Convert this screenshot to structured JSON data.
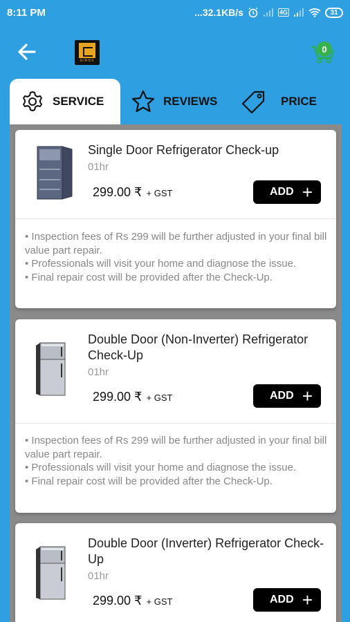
{
  "status": {
    "time": "8:11 PM",
    "speed": "...32.1KB/s",
    "network": "4G",
    "battery": "31"
  },
  "header": {
    "logo_text": "GIRDS",
    "cart_count": "0"
  },
  "tabs": [
    {
      "label": "SERVICE"
    },
    {
      "label": "REVIEWS"
    },
    {
      "label": "PRICE"
    }
  ],
  "services": [
    {
      "title": "Single Door Refrigerator Check-up",
      "duration": "01hr",
      "price": "299.00 ₹",
      "gst": "+ GST",
      "add_label": "ADD",
      "notes": [
        "•  Inspection fees of Rs 299 will be further adjusted in your final bill value part repair.",
        "•  Professionals will visit your home and diagnose the issue.",
        "•  Final repair cost will be provided after the Check-Up."
      ]
    },
    {
      "title": "Double Door (Non-Inverter) Refrigerator Check-Up",
      "duration": "01hr",
      "price": "299.00 ₹",
      "gst": "+ GST",
      "add_label": "ADD",
      "notes": [
        "•  Inspection fees of Rs 299 will be further adjusted in your final bill value part repair.",
        "•  Professionals will visit your home and diagnose the issue.",
        "•  Final repair cost will be provided after the Check-Up."
      ]
    },
    {
      "title": "Double Door (Inverter) Refrigerator Check-Up",
      "duration": "01hr",
      "price": "299.00 ₹",
      "gst": "+ GST",
      "add_label": "ADD",
      "notes": []
    }
  ]
}
